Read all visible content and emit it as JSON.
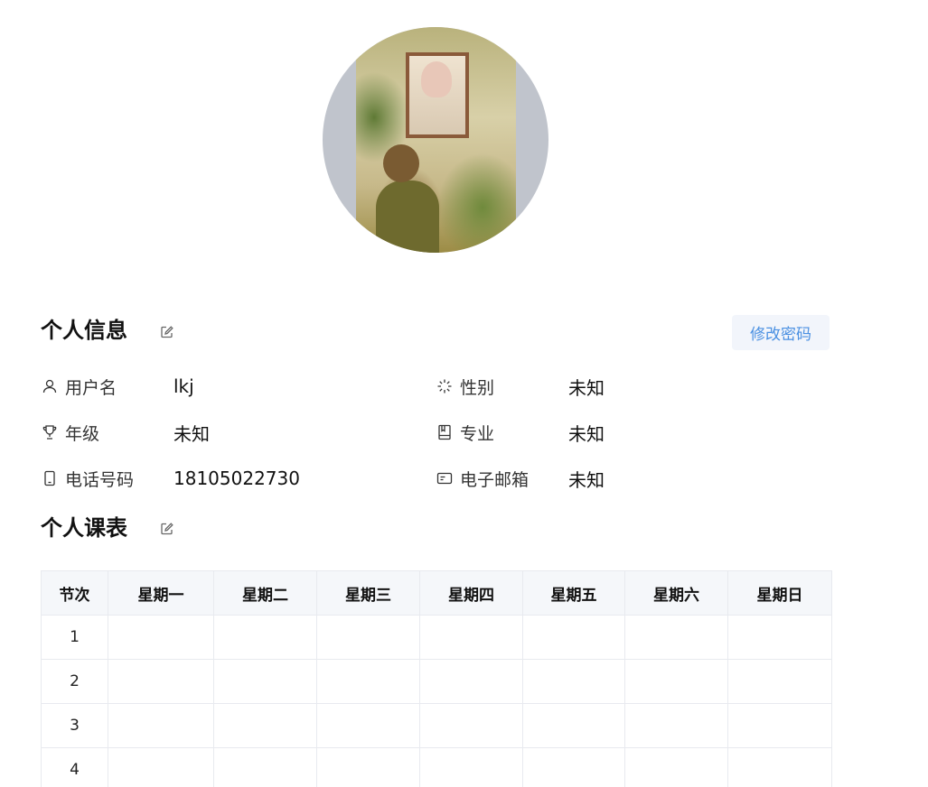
{
  "profile": {
    "avatar_alt": "头像"
  },
  "info_section": {
    "title": "个人信息",
    "change_password_label": "修改密码",
    "fields": [
      {
        "icon": "user-icon",
        "label": "用户名",
        "value": "lkj"
      },
      {
        "icon": "gender-icon",
        "label": "性别",
        "value": "未知"
      },
      {
        "icon": "trophy-icon",
        "label": "年级",
        "value": "未知"
      },
      {
        "icon": "book-icon",
        "label": "专业",
        "value": "未知"
      },
      {
        "icon": "phone-icon",
        "label": "电话号码",
        "value": "18105022730"
      },
      {
        "icon": "mail-card-icon",
        "label": "电子邮箱",
        "value": "未知"
      }
    ]
  },
  "schedule_section": {
    "title": "个人课表",
    "headers": [
      "节次",
      "星期一",
      "星期二",
      "星期三",
      "星期四",
      "星期五",
      "星期六",
      "星期日"
    ],
    "rows": [
      [
        "1",
        "",
        "",
        "",
        "",
        "",
        "",
        ""
      ],
      [
        "2",
        "",
        "",
        "",
        "",
        "",
        "",
        ""
      ],
      [
        "3",
        "",
        "",
        "",
        "",
        "",
        "",
        ""
      ],
      [
        "4",
        "",
        "",
        "",
        "",
        "",
        "",
        ""
      ]
    ]
  },
  "colors": {
    "accent": "#4a90e2",
    "button_bg": "#f2f5fb",
    "table_header_bg": "#f5f7fa",
    "border": "#e8eaef"
  }
}
